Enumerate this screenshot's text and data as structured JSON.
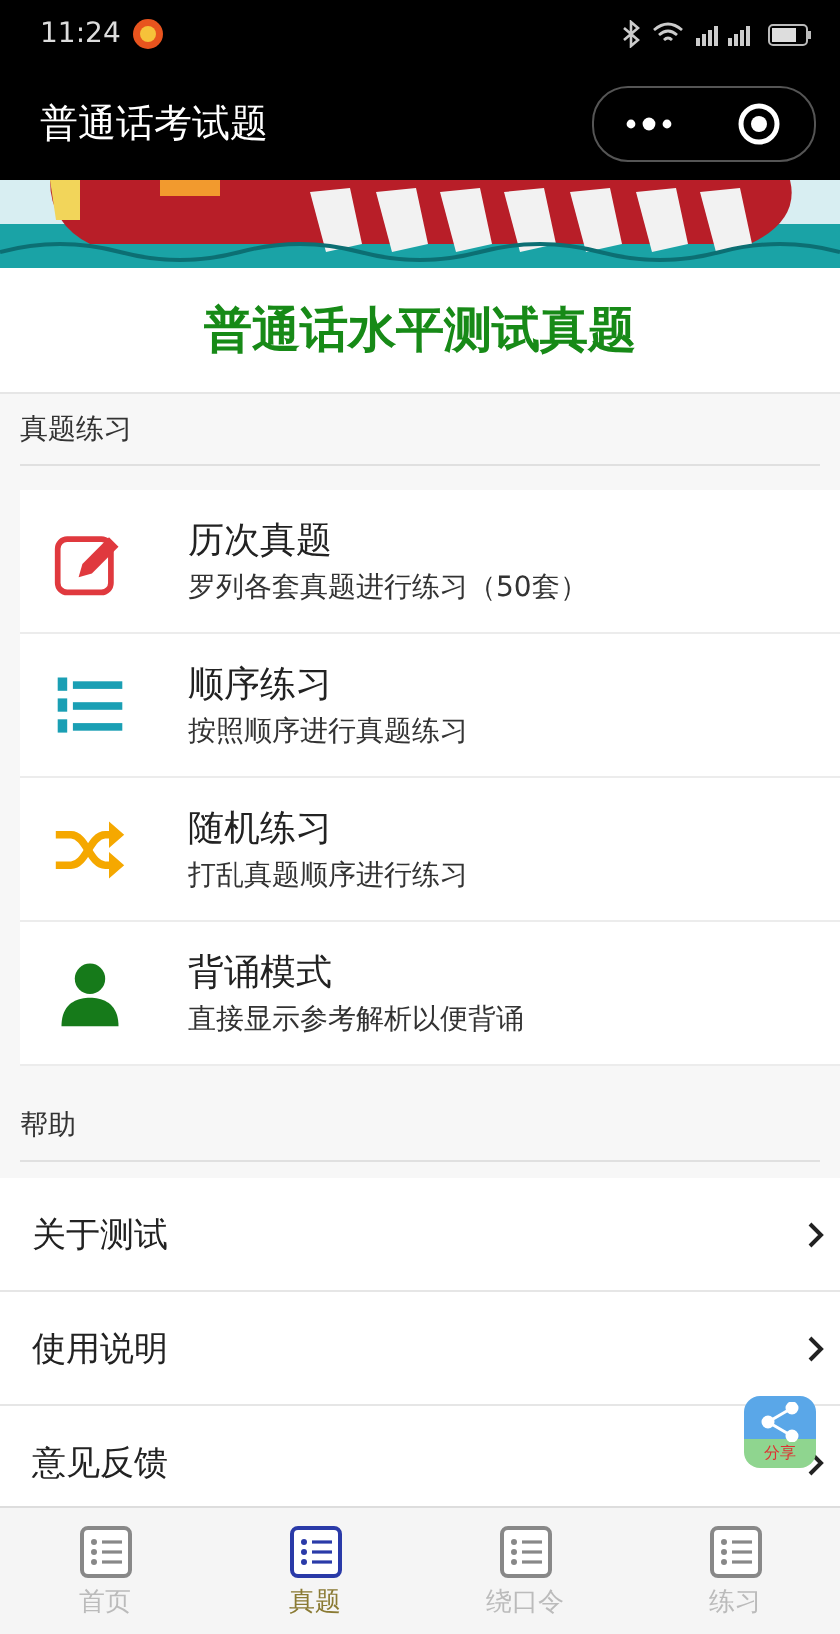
{
  "status_bar": {
    "time": "11:24"
  },
  "nav_bar": {
    "title": "普通话考试题"
  },
  "heading": "普通话水平测试真题",
  "practice_section": {
    "title": "真题练习",
    "items": [
      {
        "kind": "edit",
        "title": "历次真题",
        "subtitle": "罗列各套真题进行练习（50套）"
      },
      {
        "kind": "ordered",
        "title": "顺序练习",
        "subtitle": "按照顺序进行真题练习"
      },
      {
        "kind": "shuffle",
        "title": "随机练习",
        "subtitle": "打乱真题顺序进行练习"
      },
      {
        "kind": "person",
        "title": "背诵模式",
        "subtitle": "直接显示参考解析以便背诵"
      }
    ]
  },
  "help_section": {
    "title": "帮助",
    "items": [
      {
        "label": "关于测试"
      },
      {
        "label": "使用说明"
      },
      {
        "label": "意见反馈"
      }
    ]
  },
  "share_button": {
    "label": "分享"
  },
  "tab_bar": [
    {
      "label": "首页",
      "selected": false
    },
    {
      "label": "真题",
      "selected": true
    },
    {
      "label": "绕口令",
      "selected": false
    },
    {
      "label": "练习",
      "selected": false
    }
  ]
}
